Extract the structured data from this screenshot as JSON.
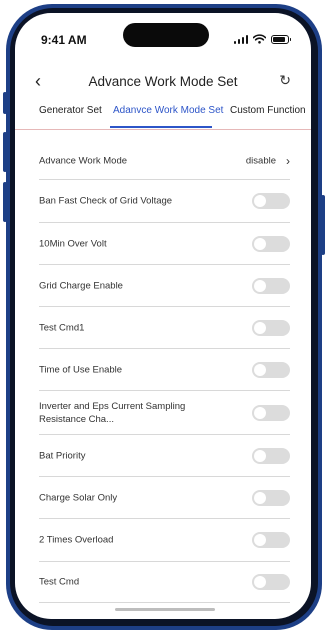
{
  "status_bar": {
    "time": "9:41 AM"
  },
  "header": {
    "back_icon": "chevron-left-icon",
    "title": "Advance Work Mode Set",
    "refresh_icon": "refresh-icon"
  },
  "tabs": [
    {
      "label": "Generator Set",
      "active": false
    },
    {
      "label": "Adanvce Work Mode Set",
      "active": true
    },
    {
      "label": "Custom Function",
      "active": false
    }
  ],
  "settings": {
    "advance_work_mode": {
      "label": "Advance Work Mode",
      "value": "disable"
    },
    "toggles": [
      {
        "label": "Ban Fast Check of Grid Voltage",
        "on": false
      },
      {
        "label": "10Min Over Volt",
        "on": false
      },
      {
        "label": "Grid Charge Enable",
        "on": false
      },
      {
        "label": "Test Cmd1",
        "on": false
      },
      {
        "label": "Time of Use Enable",
        "on": false
      },
      {
        "label": "Inverter and Eps Current Sampling Resistance Cha...",
        "on": false
      },
      {
        "label": "Bat Priority",
        "on": false
      },
      {
        "label": "Charge Solar Only",
        "on": false
      },
      {
        "label": "2 Times Overload",
        "on": false
      },
      {
        "label": "Test Cmd",
        "on": false
      }
    ]
  },
  "colors": {
    "frame": "#1d3f86",
    "accent": "#2d55c8",
    "toggle_off": "#dcdcdc",
    "tab_border": "#e6b8b8"
  }
}
